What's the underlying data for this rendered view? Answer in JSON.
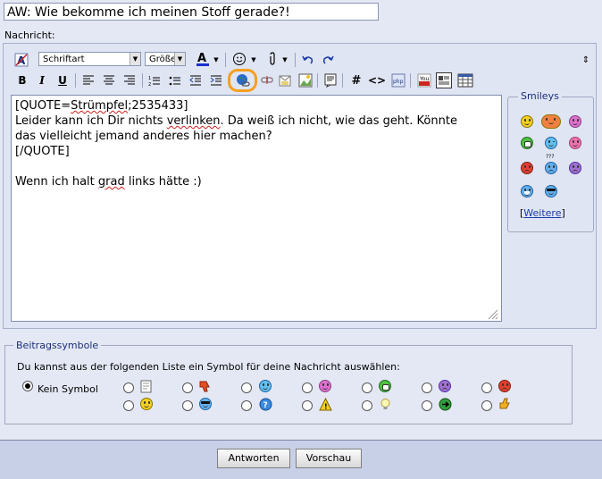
{
  "subject": {
    "value": "AW: Wie bekomme ich meinen Stoff gerade?!"
  },
  "message_label": "Nachricht:",
  "toolbar": {
    "font_select": "Schriftart",
    "size_select": "Größe",
    "bold": "B",
    "italic": "I",
    "underline": "U",
    "hash": "#",
    "code": "<>",
    "collapse": "⇕",
    "highlight_color": "#f5a020"
  },
  "editor": {
    "lines": [
      "[QUOTE=Strümpfel;2535433]",
      "Leider kann ich Dir nichts verlinken. Da weiß ich nicht, wie das geht. Könnte",
      "das vielleicht jemand anderes hier machen?",
      "[/QUOTE]",
      "",
      "Wenn ich halt grad links hätte :)"
    ]
  },
  "smileys": {
    "legend": "Smileys",
    "more_link": "Weitere",
    "more_prefix": "[",
    "more_suffix": "]"
  },
  "post_icons": {
    "legend": "Beitragssymbole",
    "description": "Du kannst aus der folgenden Liste ein Symbol für deine Nachricht auswählen:",
    "none_label": "Kein Symbol",
    "selected": "Kein Symbol"
  },
  "buttons": {
    "submit": "Antworten",
    "preview": "Vorschau"
  },
  "colors": {
    "accent": "#1a2e7c",
    "link": "#1a3aa8",
    "smiley": "#f5d020"
  }
}
